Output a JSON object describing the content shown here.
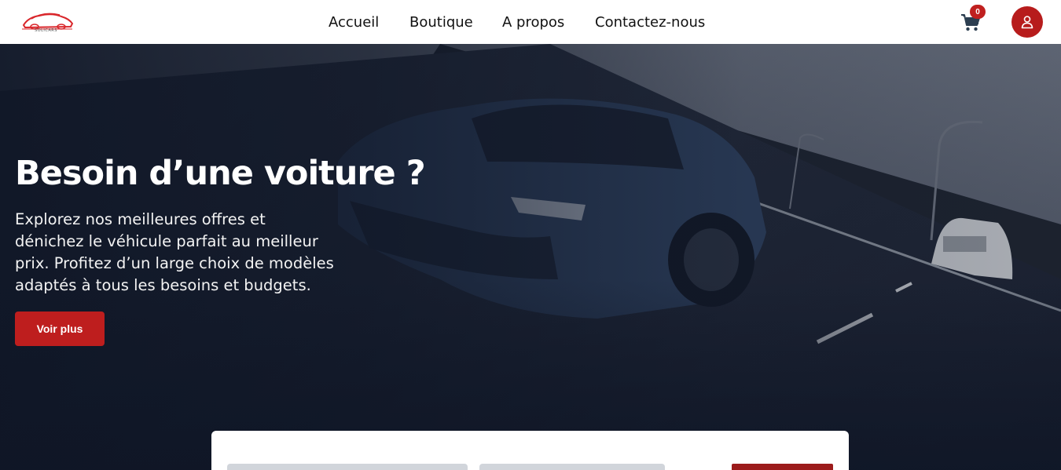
{
  "header": {
    "logo_alt": "SOLICARS",
    "nav": [
      {
        "label": "Accueil"
      },
      {
        "label": "Boutique"
      },
      {
        "label": "A propos"
      },
      {
        "label": "Contactez-nous"
      }
    ],
    "cart_count": "0",
    "icons": {
      "cart": "cart-icon",
      "user": "user-icon"
    }
  },
  "hero": {
    "title": "Besoin d’une voiture ?",
    "description": "Explorez nos meilleures offres et dénichez le véhicule parfait au meilleur prix. Profitez d’un large choix de modèles adaptés à tous les besoins et budgets.",
    "cta_label": "Voir plus"
  },
  "colors": {
    "accent": "#be1e1e",
    "hero_dark": "#0f1624",
    "header_bg": "#ffffff"
  }
}
